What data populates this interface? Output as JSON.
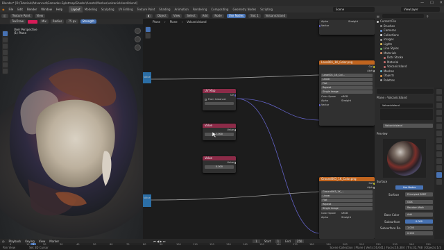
{
  "titlebar": {
    "title": "Blender* [D:\\Tutorials\\Advanced\\Gamedev-Splatmap\\Shader\\Assets\\Meshes\\volcanicIsland.blend]",
    "controls": [
      "—",
      "□",
      "✕"
    ]
  },
  "menubar": {
    "menus": [
      "File",
      "Edit",
      "Render",
      "Window",
      "Help"
    ],
    "workspaces": [
      "Layout",
      "Modeling",
      "Sculpting",
      "UV Editing",
      "Texture Paint",
      "Shading",
      "Animation",
      "Rendering",
      "Compositing",
      "Geometry Nodes",
      "Scripting"
    ],
    "active_workspace": "Layout",
    "scene": "Scene",
    "view_layer": "ViewLayer"
  },
  "viewport": {
    "mode": "Texture Paint",
    "view_menu": "View",
    "brush": "TexDraw",
    "blend": "Mix",
    "radius_label": "Radius",
    "radius_value": "75 px",
    "strength_label": "Strength",
    "info_line1": "User Perspective",
    "info_line2": "(1) Plane",
    "brush_color": "#d81b58"
  },
  "node_editor": {
    "header": [
      "Object",
      "View",
      "Select",
      "Add",
      "Node"
    ],
    "use_nodes": "Use Nodes",
    "slot": "Slot 1",
    "material": "VolcanicIsland",
    "breadcrumb": [
      "Plane",
      "Plane",
      "VolcanicIsland"
    ],
    "top_partial": {
      "alpha": "Alpha",
      "straight": "Straight",
      "vector": "Vector"
    },
    "tex1": {
      "title": "Lava001_1K_Color.png",
      "right_labels": [
        "Col",
        "Alph"
      ],
      "image": "Lava001_1K_Col...",
      "interp": "Linear",
      "proj": "Flat",
      "ext": "Repeat",
      "source": "Single Image",
      "cs_label": "Color Space",
      "cs_value": "sRGB",
      "alpha_label": "Alpha",
      "alpha_value": "Straight",
      "vector": "Vector"
    },
    "tex2": {
      "title": "Ground063_1K_Color.png",
      "right_labels": [
        "Col",
        "Alph"
      ],
      "image": "Ground063_1K_...",
      "interp": "Linear",
      "proj": "Flat",
      "ext": "Repeat",
      "source": "Single Image",
      "cs_label": "Color Space",
      "cs_value": "sRGB",
      "alpha_label": "Alpha",
      "alpha_value": "Straight",
      "vector": "Vector"
    },
    "value_left_label": "Value",
    "uvmap": {
      "title": "UV Map",
      "out": "UV",
      "from_instancer": "From Instancer"
    },
    "value1": {
      "title": "Value",
      "out": "Value",
      "num": "1.000"
    },
    "value2": {
      "title": "Value",
      "out": "Value",
      "num": "0.000"
    }
  },
  "outliner": {
    "root": "Current File",
    "items": [
      {
        "label": "Brushes",
        "color": "#8a8a8a"
      },
      {
        "label": "Cameras",
        "color": "#6d9be2"
      },
      {
        "label": "Collections",
        "color": "#e0e0e0"
      },
      {
        "label": "Images",
        "color": "#a1a1a1"
      },
      {
        "label": "Lights",
        "color": "#e3c25a"
      },
      {
        "label": "Line Styles",
        "color": "#7ab56b"
      },
      {
        "label": "Materials",
        "color": "#e0906a"
      },
      {
        "label": "Dots Stroke",
        "color": "#c86f6f"
      },
      {
        "label": "Material",
        "color": "#c86f6f"
      },
      {
        "label": "VolcanicIsland",
        "color": "#c86f6f"
      },
      {
        "label": "Meshes",
        "color": "#6bb5c9"
      },
      {
        "label": "Objects",
        "color": "#e39a4a"
      },
      {
        "label": "Palettes",
        "color": "#a1a1a1"
      }
    ]
  },
  "properties": {
    "crumb_a": "Plane",
    "crumb_b": "VolcanicIsland",
    "slot_item": "VolcanicIsland",
    "mat_field": "VolcanicIsland",
    "preview_label": "Preview",
    "surface_label": "Surface",
    "use_nodes": "Use Nodes",
    "surface_row_label": "Surface",
    "surface_value": "Principled BSDF",
    "dist1": "GGX",
    "dist2": "Random Walk",
    "base_color_label": "Base Color",
    "base_color_value": "Add",
    "subsurface_label": "Subsurface",
    "subsurface_value": "0.000",
    "subsurface_radius_label": "Subsurface Ra.",
    "sr1": "1.000",
    "sr2": "0.200"
  },
  "timeline": {
    "menus": [
      "Playback",
      "Keying",
      "View",
      "Marker"
    ],
    "current_frame": "1",
    "start_label": "Start",
    "start": "1",
    "end_label": "End",
    "end": "250",
    "ticks": [
      "0",
      "10",
      "20",
      "30",
      "40",
      "50",
      "60",
      "70",
      "80",
      "90",
      "100",
      "110",
      "120",
      "130",
      "140",
      "150",
      "160",
      "170",
      "180",
      "190",
      "200",
      "210",
      "220",
      "230",
      "240",
      "250"
    ]
  },
  "status": {
    "left": "Pan View",
    "middle": "Set 3D Cursor",
    "right": "Scene Collection | Plane | Verts:16,641 | Faces:16,384 | Tris:32,768 | Objects:1/3"
  }
}
